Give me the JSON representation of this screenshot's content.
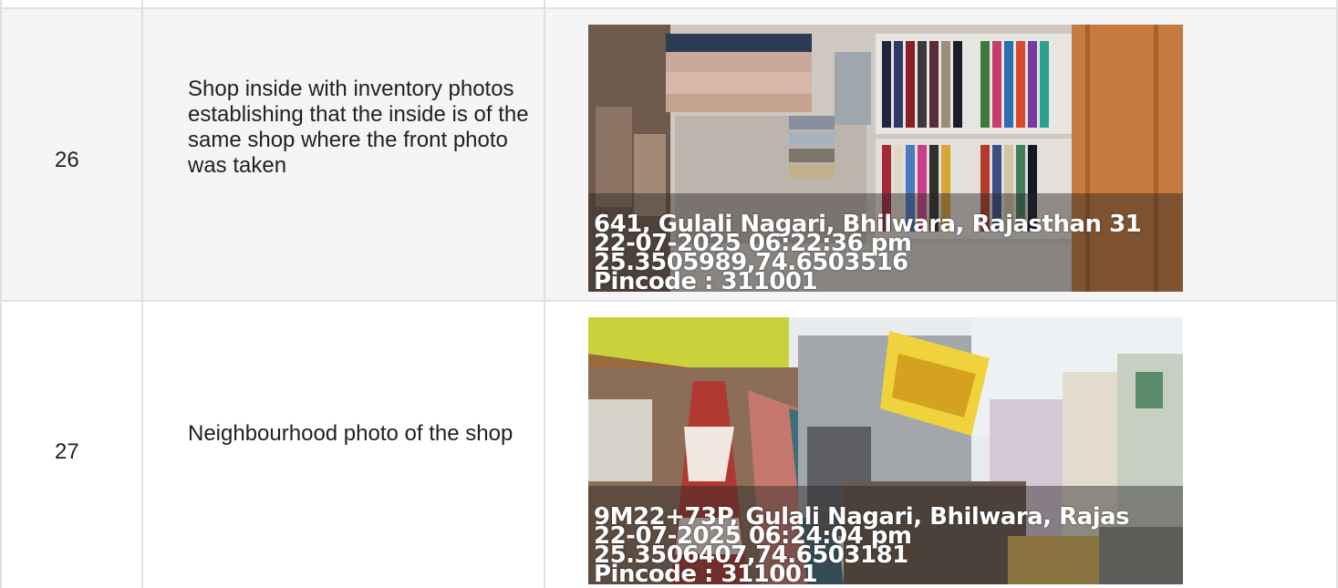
{
  "rows": [
    {
      "number": "26",
      "description": "Shop inside with inventory photos establishing that the inside is of the same shop where the front photo was taken",
      "photo": {
        "subject": "shop-interior-inventory",
        "stamp": {
          "address": "641, Gulali Nagari, Bhilwara, Rajasthan 31",
          "datetime": "22-07-2025 06:22:36 pm",
          "coords": "25.3505989,74.6503516",
          "pincode": "Pincode : 311001"
        }
      }
    },
    {
      "number": "27",
      "description": "Neighbourhood photo of the shop",
      "photo": {
        "subject": "shop-neighbourhood-street",
        "stamp": {
          "address": "9M22+73P, Gulali Nagari, Bhilwara, Rajas",
          "datetime": "22-07-2025 06:24:04 pm",
          "coords": "25.3506407,74.6503181",
          "pincode": "Pincode : 311001"
        }
      }
    }
  ],
  "colors": {
    "grid": "#e0e0e0",
    "row_alt_bg": "#f5f5f5",
    "text": "#212121"
  }
}
